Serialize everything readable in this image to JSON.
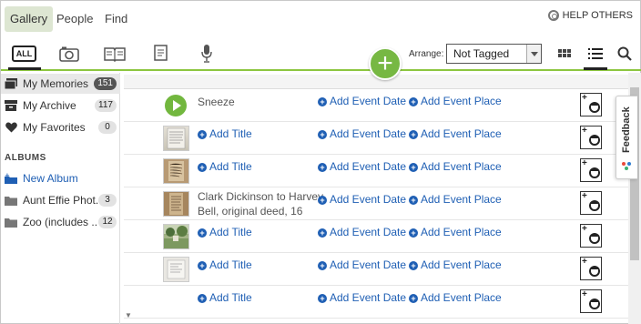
{
  "nav": {
    "tabs": [
      "Gallery",
      "People",
      "Find"
    ],
    "active": "Gallery",
    "help_label": "HELP OTHERS"
  },
  "toolbar": {
    "all_label": "ALL",
    "arrange_label": "Arrange:",
    "arrange_value": "Not Tagged",
    "icons": [
      "photo-icon",
      "story-icon",
      "document-icon",
      "audio-icon",
      "grid-view-icon",
      "list-view-icon",
      "search-icon"
    ]
  },
  "sidebar": {
    "items": [
      {
        "label": "My Memories",
        "count": "151",
        "icon": "photos-icon"
      },
      {
        "label": "My Archive",
        "count": "117",
        "icon": "archive-icon"
      },
      {
        "label": "My Favorites",
        "count": "0",
        "icon": "heart-icon"
      }
    ],
    "albums_heading": "ALBUMS",
    "new_album": "New Album",
    "albums": [
      {
        "label": "Aunt Effie Phot...",
        "count": "3"
      },
      {
        "label": "Zoo (includes ...",
        "count": "12"
      }
    ]
  },
  "list": {
    "add_title": "Add Title",
    "add_date": "Add Event Date",
    "add_place": "Add Event Place",
    "rows": [
      {
        "title": "Sneeze",
        "title_line2": "",
        "thumb": "audio"
      },
      {
        "title": "",
        "title_line2": "",
        "thumb": "document"
      },
      {
        "title": "",
        "title_line2": "",
        "thumb": "letter"
      },
      {
        "title": "Clark Dickinson to Harvey",
        "title_line2": "Bell, original deed, 16",
        "thumb": "deed"
      },
      {
        "title": "",
        "title_line2": "",
        "thumb": "photo"
      },
      {
        "title": "",
        "title_line2": "",
        "thumb": "paper"
      },
      {
        "title": "",
        "title_line2": "",
        "thumb": "none"
      }
    ]
  },
  "feedback_label": "Feedback",
  "colors": {
    "accent_green": "#77b843",
    "link_blue": "#1f5fb4"
  }
}
